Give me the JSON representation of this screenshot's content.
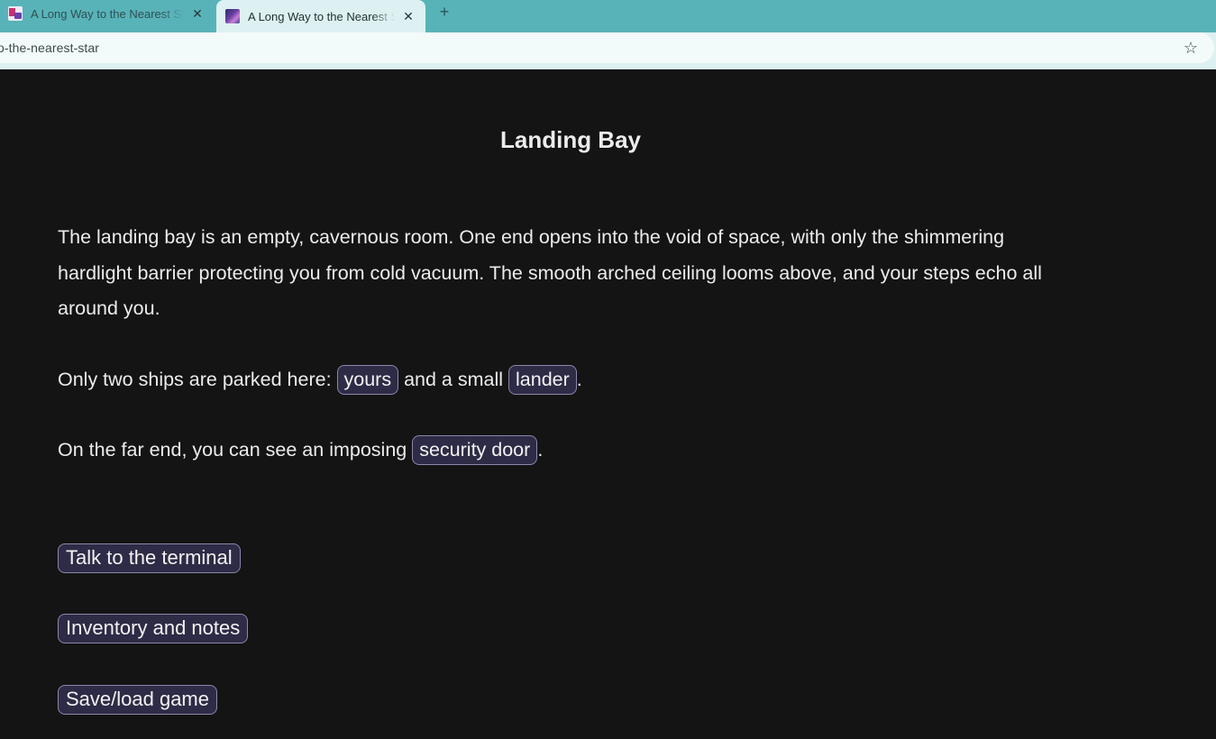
{
  "browser": {
    "tabs": [
      {
        "title": "A Long Way to the Nearest Star",
        "icon": "ifdb-favicon-icon",
        "active": false
      },
      {
        "title": "A Long Way to the Nearest Star",
        "icon": "game-cover-favicon-icon",
        "active": true
      }
    ],
    "new_tab_icon": "+",
    "close_icon": "✕",
    "url": "o-the-nearest-star",
    "bookmark_icon": "☆"
  },
  "room": {
    "title": "Landing Bay",
    "description": "The landing bay is an empty, cavernous room. One end opens into the void of space, with only the shimmering hardlight barrier protecting you from cold vacuum. The smooth arched ceiling looms above, and your steps echo all around you.",
    "ships_prefix": "Only two ships are parked here: ",
    "ships_link_1": "yours",
    "ships_middle": " and a small ",
    "ships_link_2": "lander",
    "ships_suffix": ".",
    "door_prefix": "On the far end, you can see an imposing ",
    "door_link": "security door",
    "door_suffix": "."
  },
  "choices": [
    {
      "label": "Talk to the terminal"
    },
    {
      "label": "Inventory and notes"
    },
    {
      "label": "Save/load game"
    }
  ],
  "colors": {
    "tabbar": "#58b3b9",
    "toolbar": "#def1f2",
    "page_background": "#141414",
    "text": "#ececec",
    "link_background": "#2e2b46",
    "link_border": "#8a87ab"
  }
}
